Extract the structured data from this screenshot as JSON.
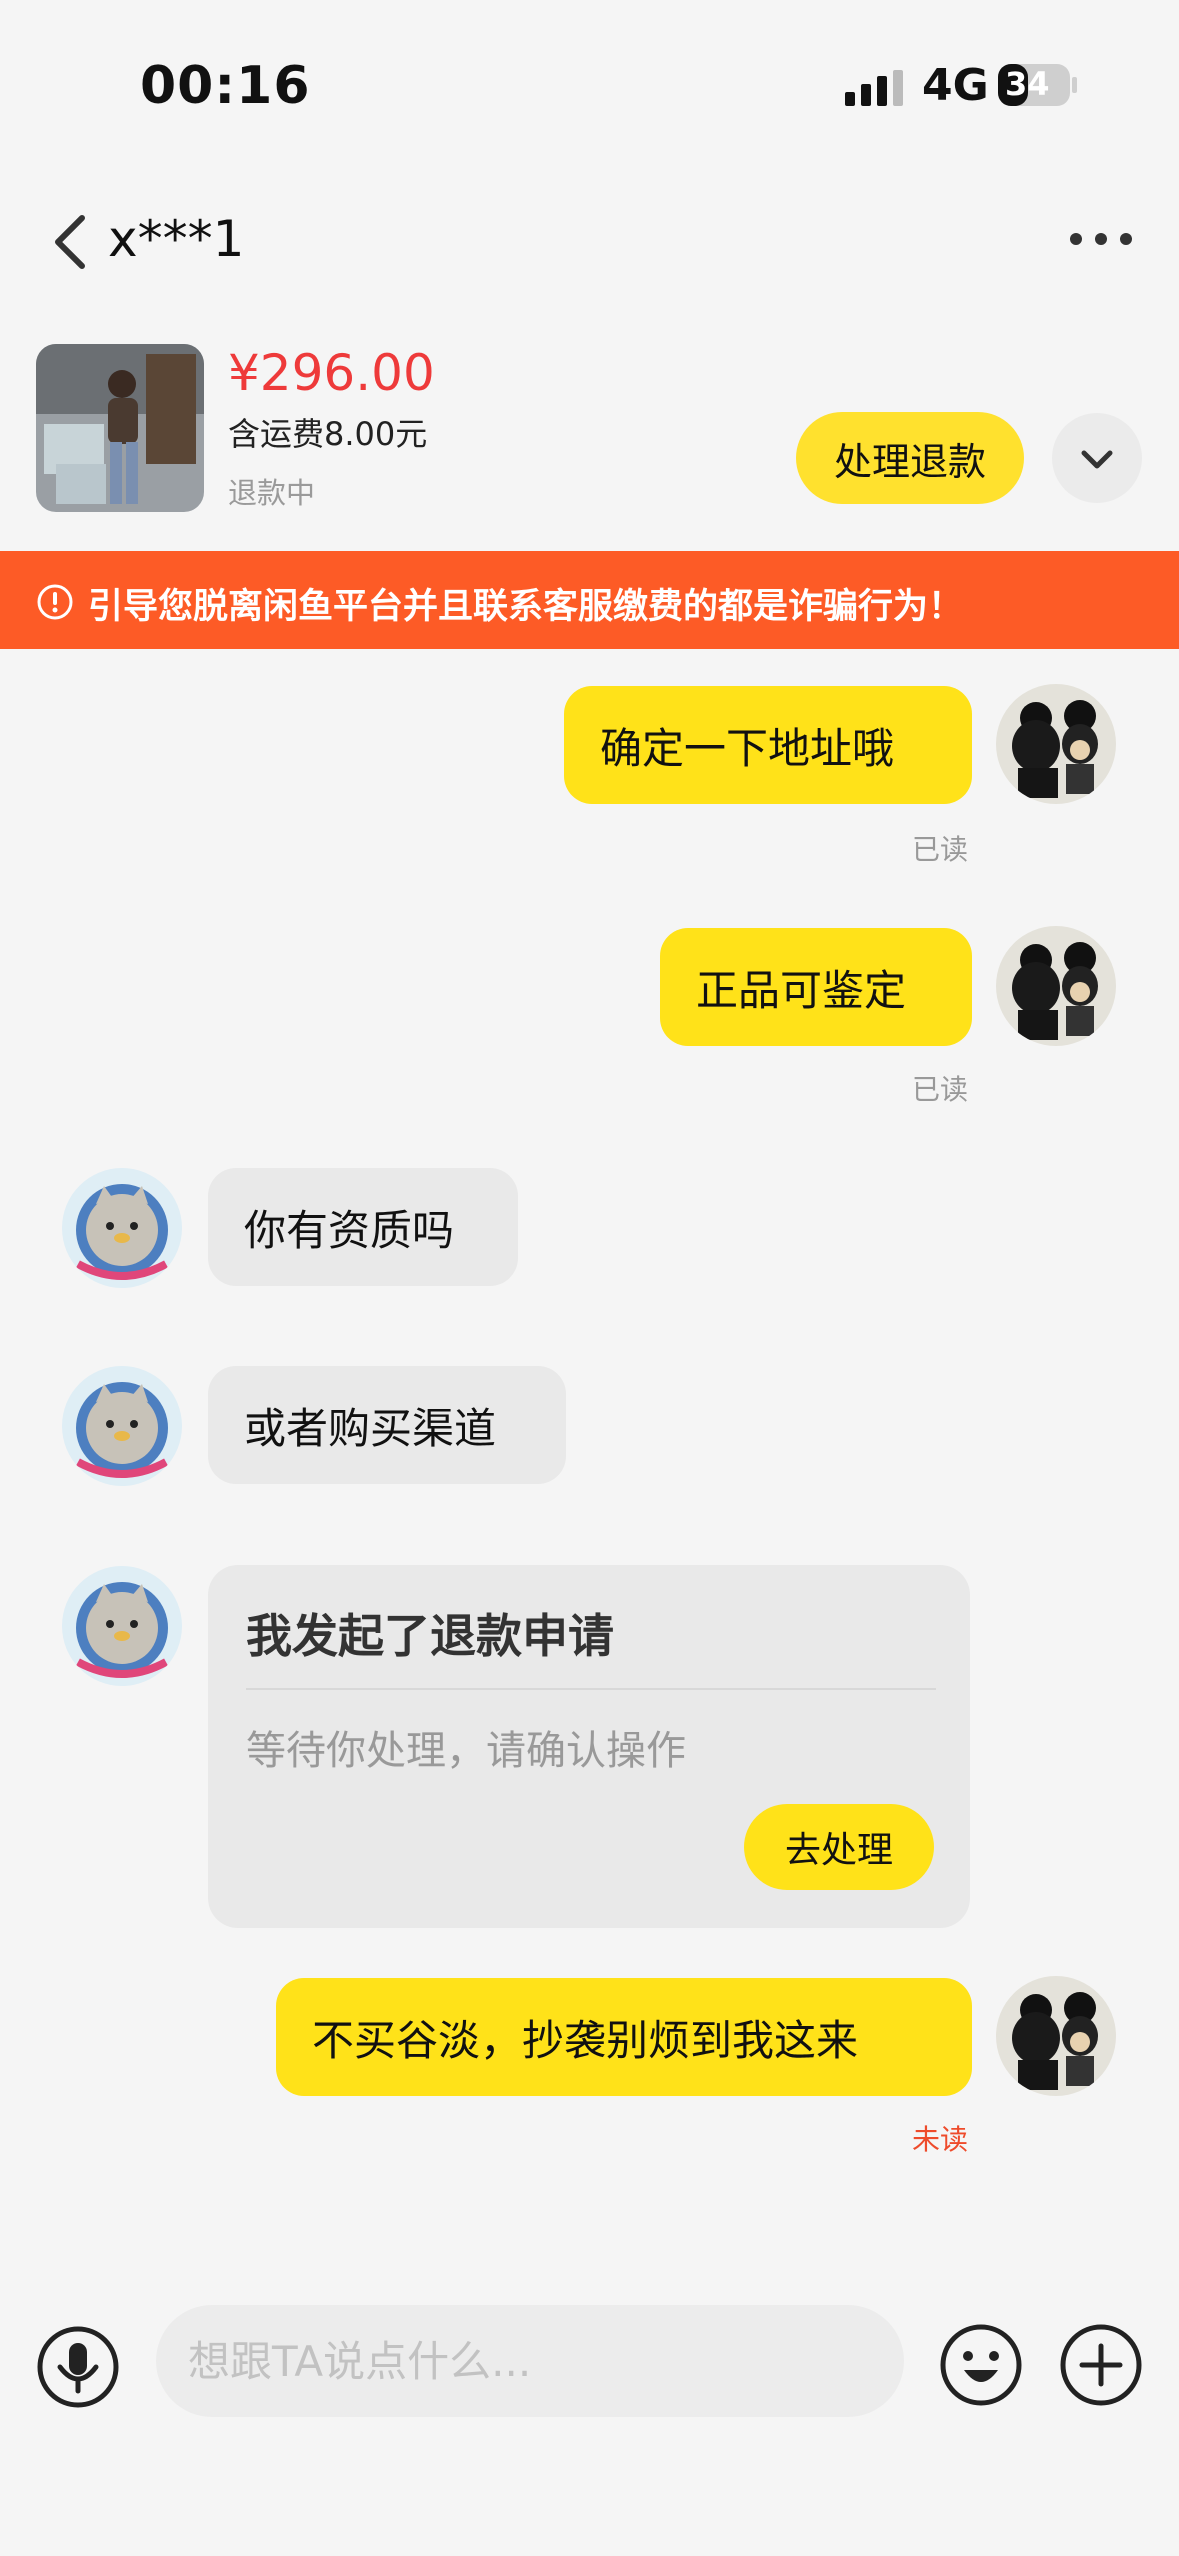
{
  "status_bar": {
    "time": "00:16",
    "network": "4G",
    "battery": "34"
  },
  "nav": {
    "title": "x***1"
  },
  "product": {
    "price": "¥296.00",
    "shipping": "含运费8.00元",
    "status": "退款中",
    "action_label": "处理退款"
  },
  "warning": {
    "text": "引导您脱离闲鱼平台并且联系客服缴费的都是诈骗行为！"
  },
  "messages": [
    {
      "side": "right",
      "text": "确定一下地址哦",
      "receipt": "已读"
    },
    {
      "side": "right",
      "text": "正品可鉴定",
      "receipt": "已读"
    },
    {
      "side": "left",
      "text": "你有资质吗"
    },
    {
      "side": "left",
      "text": "或者购买渠道"
    },
    {
      "side": "left",
      "card": {
        "title": "我发起了退款申请",
        "subtitle": "等待你处理，请确认操作",
        "button": "去处理"
      }
    },
    {
      "side": "right",
      "text": "不买谷淡，抄袭别烦到我这来",
      "receipt": "未读"
    }
  ],
  "input": {
    "placeholder": "想跟TA说点什么..."
  },
  "colors": {
    "accent_yellow": "#ffe219",
    "price_red": "#ee3a3a",
    "warning_orange": "#fd5b26",
    "unread_red": "#ee4b2b"
  },
  "icons": [
    "back-icon",
    "more-icon",
    "chevron-down-icon",
    "warning-icon",
    "mic-icon",
    "emoji-icon",
    "plus-icon"
  ]
}
